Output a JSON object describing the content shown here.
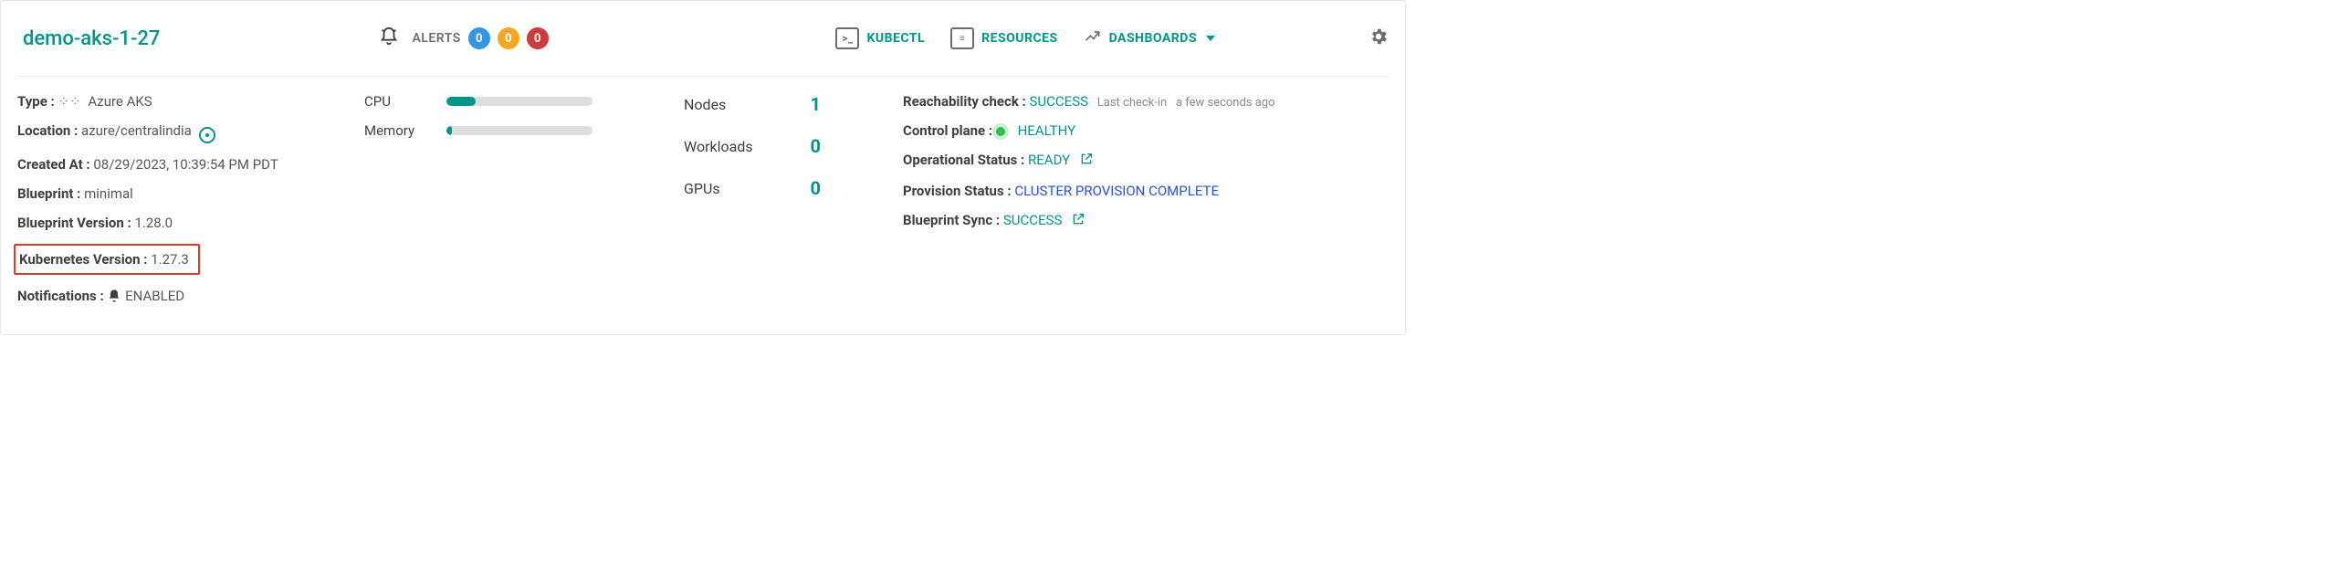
{
  "header": {
    "cluster_name": "demo-aks-1-27",
    "alerts_label": "ALERTS",
    "alert_counts": {
      "info": "0",
      "warning": "0",
      "critical": "0"
    },
    "nav": {
      "kubectl": "KUBECTL",
      "resources": "RESOURCES",
      "dashboards": "DASHBOARDS"
    }
  },
  "info": {
    "type_label": "Type :",
    "type_value": "Azure AKS",
    "location_label": "Location :",
    "location_value": "azure/centralindia",
    "created_label": "Created At :",
    "created_value": "08/29/2023, 10:39:54 PM PDT",
    "blueprint_label": "Blueprint :",
    "blueprint_value": "minimal",
    "bp_ver_label": "Blueprint Version :",
    "bp_ver_value": "1.28.0",
    "k8s_ver_label": "Kubernetes Version :",
    "k8s_ver_value": "1.27.3",
    "notif_label": "Notifications :",
    "notif_value": "ENABLED"
  },
  "usage": {
    "cpu_label": "CPU",
    "cpu_pct": 20,
    "mem_label": "Memory",
    "mem_pct": 4
  },
  "counts": {
    "nodes_label": "Nodes",
    "nodes_value": "1",
    "workloads_label": "Workloads",
    "workloads_value": "0",
    "gpus_label": "GPUs",
    "gpus_value": "0"
  },
  "status": {
    "reach_label": "Reachability check :",
    "reach_value": "SUCCESS",
    "reach_note_prefix": "Last check-in",
    "reach_note_value": "a few seconds ago",
    "cp_label": "Control plane :",
    "cp_value": "HEALTHY",
    "op_label": "Operational Status :",
    "op_value": "READY",
    "prov_label": "Provision Status :",
    "prov_value": "CLUSTER PROVISION COMPLETE",
    "sync_label": "Blueprint Sync :",
    "sync_value": "SUCCESS"
  }
}
